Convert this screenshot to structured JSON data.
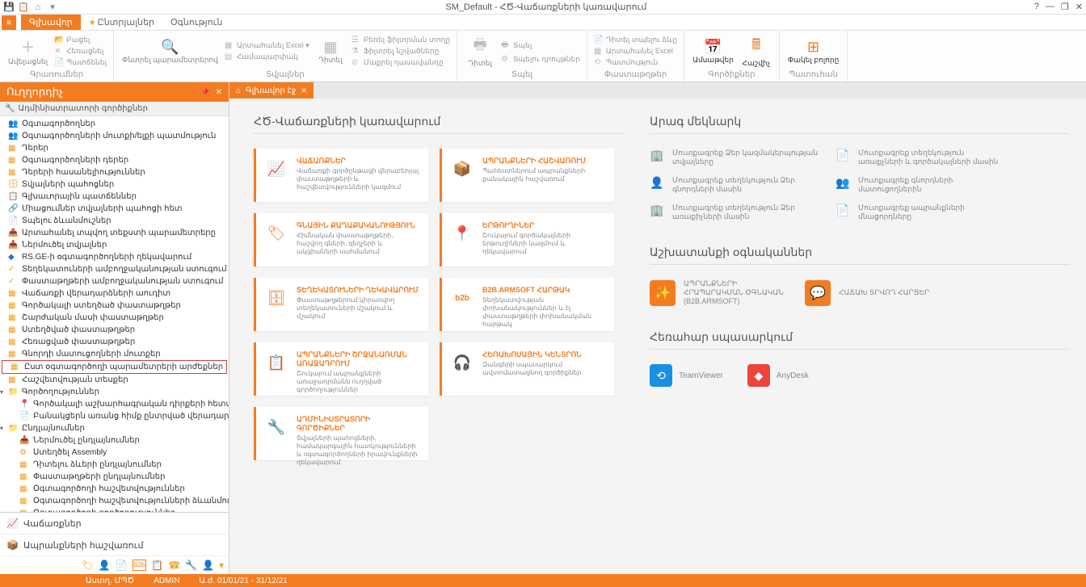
{
  "titlebar": {
    "title": "SM_Default - ՀԾ-Վաճառքների կառավարում",
    "help": "?",
    "min": "—",
    "max": "❐",
    "close": "✕"
  },
  "ribbonTabs": {
    "main": "Գլխավոր",
    "starred": "Ընտրյալներ",
    "help": "Օգնություն"
  },
  "ribbon": {
    "add": "Ավելացնել",
    "open": "Բացել",
    "remove": "Հեռացնել",
    "duplicate": "Պատճենել",
    "filter": "Փնտրել պարամետրերով",
    "filterExcel": "Արտահանել Excel ▾",
    "filterHide": "Համապարփակ",
    "openFilter": "Բեռել ֆիլտրման տողը",
    "filterRows": "Ֆիլտրել նշվածները",
    "clearFilter": "Մաքրել դասավանդը",
    "view": "Դիտել",
    "print": "Տպել",
    "export": "Տպելու դրույթներ",
    "params": "Դիտել տպելու ձևը",
    "exportExcel": "Արտահանել Excel",
    "journal": "Պատմություն",
    "calendar": "Ամսաթվեր",
    "calc": "Հաշվիչ",
    "close": "Փակել բոլորը",
    "g_docs": "Գրառումներ",
    "g_data": "Տվյալներ",
    "g_print": "Տպել",
    "g_docs2": "Փաստաթղթեր",
    "g_tools": "Գործիքներ",
    "g_history": "Պատուհան"
  },
  "sidebar": {
    "title": "Ուղղորդիչ",
    "section": "Ադմինիստրատորի գործիքներ",
    "tree": {
      "i0": "Օգտագործողներ",
      "i1": "Օգտագործողների մուտքի/ելքի պատմություն",
      "i2": "Դերեր",
      "i3": "Օգտագործողների դերեր",
      "i4": "Դերերի հասանելիություններ",
      "i5": "Տվյալների պահոցներ",
      "i6": "Գլխաւորային պատճեններ",
      "i7": "Միացումներ տվյալների պահոցի հետ",
      "i8": "Տպելու ձևանմուշներ",
      "i9": "Արտահանել տպվող տեքստի պարամետրերը",
      "i10": "Ներմուծել տվյալներ",
      "i11": "RS.GE-ի օգտագործողների ղեկավարում",
      "i12": "Տեղեկատուների ամբողջականության ստուգում",
      "i13": "Փաստաթղթերի ամբողջականության ստուգում",
      "i14": "Վաճառքի վերադարձների աուդիտ",
      "i15": "Գործակալի ստեղծած փաստաթղթեր",
      "i16": "Շարժական մասի փաստաթղթեր",
      "i17": "Ստեղծված փաստաթղթեր",
      "i18": "Հեռացված փաստաթղթեր",
      "i19": "Գնորդի մատուցողների մուտքեր",
      "i20": "Ըստ օգտագործողի պարամետրերի արժեքներ",
      "i21": "Հաշվետվության տեսքեր",
      "i22": "Գործողություններ",
      "i23": "Գործակալի աշխարհագրական դիրքերի հետագծում",
      "i24": "Բանակցերն առանց հիմք ընտրված վերադարձերի",
      "i25": "Ընդլայնումներ",
      "i26": "Ներմուծել ընդլայնումներ",
      "i27": "Ստեղծել Assembly",
      "i28": "Դիտելու ձևերի ընդլայնումներ",
      "i29": "Փաստաթղթերի ընդլայնումներ",
      "i30": "Օգտագործողի հաշվետվություններ",
      "i31": "Օգտագործողի հաշվետվությունների ձևանմուշներ",
      "i32": "Օգտագործողի գործողություններ"
    },
    "bottom": {
      "b0": "Վաճառքներ",
      "b1": "Ապրանքների հաշվառում"
    }
  },
  "contentTab": "Գլխավոր էջ",
  "main": {
    "sectionTitle": "ՀԾ-Վաճառքների կառավարում",
    "tiles": {
      "t0": {
        "title": "ՎԱՃԱՌՔՆԵՐ",
        "desc": "Վաճառքի գործընթացի վերաբերյալ փաստաթղթերի և հաշվետվությունների կազմում"
      },
      "t1": {
        "title": "ԱՊՐԱՆՔՆԵՐԻ ՀԱՇՎԱՌՈՒՄ",
        "desc": "Պահեստներում ապրանքների քանակային հաշվառում"
      },
      "t2": {
        "title": "ԳՆԱՅԻՆ ՔԱՂԱՔԱԿԱՆՈՒԹՅՈՒՆ",
        "desc": "Հիմնական փաստաթղթերի, հաշվող գների, զեղչերի և ակցիաների սահմանում"
      },
      "t3": {
        "title": "ԵՐԹՈՒՂԻՆԵՐ",
        "desc": "Շուկայում գործակալների երթուղիների կազմում և ղեկավարում"
      },
      "t4": {
        "title": "ՏԵՂԵԿԱՏՈՒՆԵՐԻ ՂԵԿԱՎԱՐՈՒՄ",
        "desc": "Փաստաթղթերում կիրառվող տեղեկատուների մշակում և մշակում"
      },
      "t5": {
        "title": "B2B.ARMSOFT ՀԱՐԹԱԿ",
        "desc": "Տեղեկատվության փոխանակություններ և էլ. փաստաթղթերի փոխանակման հարթակ"
      },
      "t6": {
        "title": "ԱՊՐԱՆՔՆԵՐԻ ՇՐՋԱՆԱՌՄԱՆ ԱՌԱՋԱԴՐՈՒՄ",
        "desc": "Շուկայում ապրանքների առաջադրմանն ուղղված գործողություններ"
      },
      "t7": {
        "title": "ՀԵՌԱԽՈՍԱՅԻՆ ԿԵՆՏՐՈՆ",
        "desc": "Զանգերի սպասարկում ավտոմատացնող գործիքներ"
      },
      "t8": {
        "title": "ԱԴՄԻՆԻՍՏՐԱՏՈՐԻ ԳՈՐԾԻՔՆԵՐ",
        "desc": "Տվյալների պահոցների, համակարգային հատկությունների և օգտագործողների իրավունքների ղեկավարում"
      }
    }
  },
  "right": {
    "quick": "Արագ մեկնարկ",
    "info": {
      "i0": "Մուտքագրեք Ձեր կազմակերպության տվյալները",
      "i1": "Մուտքագրեք տեղեկություն առաքչների և գործակալների մասին",
      "i2": "Մուտքագրեք տեղեկություն Ձեր գնորդների մասին",
      "i3": "Մուտքագրեք գնորդների մատուցողներին",
      "i4": "Մուտքագրեք տեղեկություն Ձեր առաքիչների մասին",
      "i5": "Մուտքագրեք ապրանքների մնացորդները"
    },
    "help": "Աշխատանքի օգնականներ",
    "helpers": {
      "h0": "ԱՊՐԱՆՔՆԵՐԻ ՀՐԱՊԱՐԱԿՄԱՆ ՕԳՆԱԿԱՆ (B2B.ARMSOFT)",
      "h1": "ՀԱՃԱԽ ՏՐՎՈՂ ՀԱՐՑԵՐ"
    },
    "remote": "Հեռահար սպասարկում",
    "remotes": {
      "r0": "TeamViewer",
      "r1": "AnyDesk"
    }
  },
  "status": {
    "s0": "Աստղ. ՄՊԾ",
    "s1": "ADMIN",
    "s2": "Ա.ժ. 01/01/21 - 31/12/21"
  }
}
